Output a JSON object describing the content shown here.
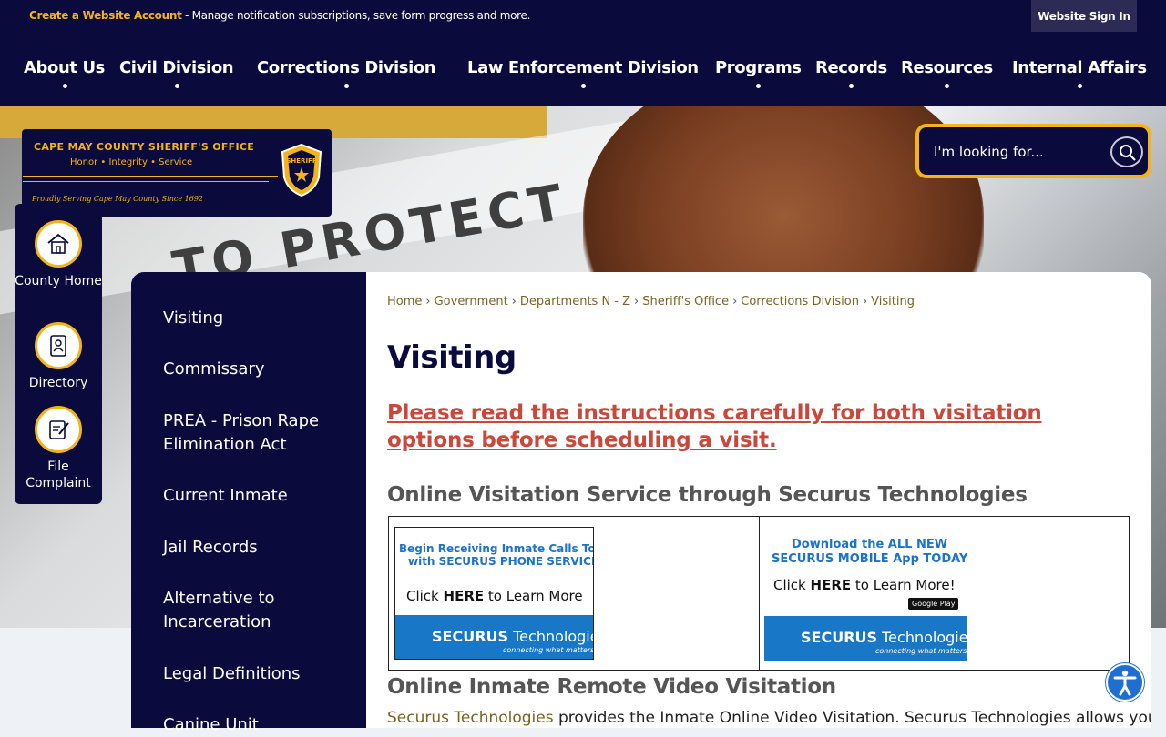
{
  "topbar": {
    "create_account": "Create a Website Account",
    "create_account_desc": " - Manage notification subscriptions, save form progress and more.",
    "signin": "Website Sign In"
  },
  "nav": [
    {
      "label": "About Us"
    },
    {
      "label": "Civil Division"
    },
    {
      "label": "Corrections Division"
    },
    {
      "label": "Law Enforcement Division"
    },
    {
      "label": "Programs"
    },
    {
      "label": "Records"
    },
    {
      "label": "Resources"
    },
    {
      "label": "Internal Affairs"
    }
  ],
  "hero": {
    "banner_text": "TO PROTECT AN"
  },
  "search": {
    "placeholder": "I'm looking for..."
  },
  "logo": {
    "title": "CAPE MAY COUNTY SHERIFF'S OFFICE",
    "motto": "Honor • Integrity • Service",
    "tagline": "Proudly Serving Cape May County Since 1692",
    "badge_text": "SHERIFF"
  },
  "quick_links": [
    {
      "label": "County Home",
      "icon": "house-icon"
    },
    {
      "label": "Directory",
      "icon": "address-book-icon"
    },
    {
      "label": "File Complaint",
      "icon": "form-edit-icon"
    }
  ],
  "side_nav": [
    {
      "label": "Visiting"
    },
    {
      "label": "Commissary"
    },
    {
      "label": "PREA - Prison Rape Elimination Act"
    },
    {
      "label": "Current Inmate"
    },
    {
      "label": "Jail Records"
    },
    {
      "label": "Alternative to Incarceration"
    },
    {
      "label": "Legal Definitions"
    },
    {
      "label": "Canine Unit"
    }
  ],
  "breadcrumb": [
    "Home",
    "Government",
    "Departments N - Z",
    "Sheriff's Office",
    "Corrections Division",
    "Visiting"
  ],
  "page": {
    "title": "Visiting",
    "warning": "Please read the instructions carefully for both visitation options before scheduling a visit.",
    "section1": "Online Visitation Service through Securus Technologies",
    "section2": "Online Inmate Remote Video Visitation",
    "para_link": "Securus Technologies",
    "para_rest": " provides the Inmate Online Video Visitation.  Securus Technologies allows you"
  },
  "ads": {
    "phone": {
      "line1a": "Begin Receiving ",
      "line1b": "Inmate Calls Today",
      "line2": "with SECURUS PHONE SERVICES!",
      "cta_a": "Click ",
      "cta_b": "HERE",
      "cta_c": " to Learn More",
      "brand_a": "SECURUS",
      "brand_b": " Technologies",
      "tag": "connecting what matters"
    },
    "app": {
      "line1": "Download the ALL NEW",
      "line2": "SECURUS MOBILE App TODAY!",
      "cta_a": "Click ",
      "cta_b": "HERE",
      "cta_c": " to Learn More!",
      "store": "Google Play",
      "brand_a": "SECURUS",
      "brand_b": " Technologies",
      "tag": "connecting what matters"
    }
  },
  "colors": {
    "navy": "#0a0a3c",
    "gold": "#f2b31b",
    "warning": "#c9483b",
    "link": "#7a6420",
    "securus_blue": "#1877c6"
  }
}
